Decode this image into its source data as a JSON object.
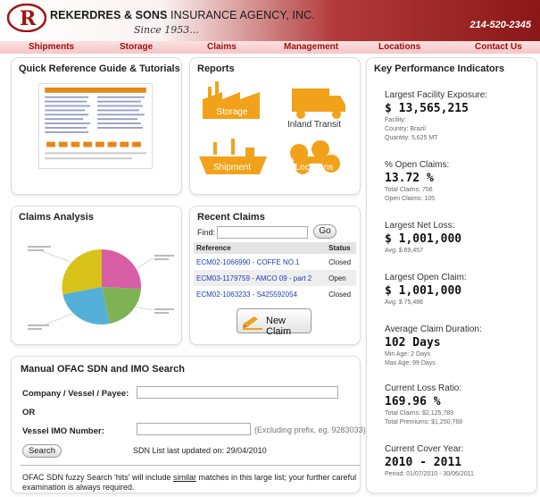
{
  "header": {
    "brand_bold": "REKERDRES & SONS",
    "brand_rest": " INSURANCE AGENCY, INC.",
    "since": "Since 1953...",
    "phone": "214-520-2345"
  },
  "nav": [
    {
      "label": "Shipments"
    },
    {
      "label": "Storage"
    },
    {
      "label": "Claims"
    },
    {
      "label": "Management"
    },
    {
      "label": "Locations"
    },
    {
      "label": "Contact Us"
    }
  ],
  "quick_reference": {
    "title": "Quick Reference Guide & Tutorials"
  },
  "reports": {
    "title": "Reports",
    "items": [
      {
        "label": "Storage",
        "icon": "warehouse-icon"
      },
      {
        "label": "Inland Transit",
        "icon": "truck-icon"
      },
      {
        "label": "Shipment",
        "icon": "ship-icon"
      },
      {
        "label": "Locations",
        "icon": "vehicles-icon"
      }
    ]
  },
  "claims_analysis": {
    "title": "Claims Analysis"
  },
  "recent_claims": {
    "title": "Recent Claims",
    "find_label": "Find:",
    "go_label": "Go",
    "columns": [
      "Reference",
      "Status"
    ],
    "rows": [
      {
        "reference": "ECM02-1066990 - COFFE NO.1",
        "status": "Closed"
      },
      {
        "reference": "ECM03-1179759 - AMCO 09 - part 2",
        "status": "Open"
      },
      {
        "reference": "ECM02-1063233 - S425592054",
        "status": "Closed"
      }
    ],
    "new_claim_label": "New Claim"
  },
  "ofac": {
    "title": "Manual OFAC SDN and IMO Search",
    "company_label": "Company / Vessel / Payee:",
    "or_label": "OR",
    "imo_label": "Vessel IMO Number:",
    "imo_hint": "(Excluding prefix, eg. 9283033)",
    "search_label": "Search",
    "sdn_updated": "SDN List last updated on: 29/04/2010",
    "note_before": "OFAC SDN fuzzy Search 'hits' will include ",
    "note_link": "similar",
    "note_after": " matches in this large list; your further careful examination is always required."
  },
  "kpi": {
    "title": "Key Performance Indicators",
    "items": [
      {
        "title": "Largest Facility Exposure:",
        "value": "$ 13,565,215",
        "subs": [
          "Facility:",
          "Country: Brazil",
          "Quantity: 5,625 MT"
        ]
      },
      {
        "title": "% Open Claims:",
        "value": "13.72 %",
        "subs": [
          "Total Claims: 756",
          "Open Claims: 105"
        ]
      },
      {
        "title": "Largest Net Loss:",
        "value": "$ 1,001,000",
        "subs": [
          "Avg: $ 69,457"
        ]
      },
      {
        "title": "Largest Open Claim:",
        "value": "$ 1,001,000",
        "subs": [
          "Avg: $ 75,486"
        ]
      },
      {
        "title": "Average Claim Duration:",
        "value": "102 Days",
        "subs": [
          "Min Age: 2 Days",
          "Max Age: 99 Days"
        ]
      },
      {
        "title": "Current Loss Ratio:",
        "value": "169.96 %",
        "subs": [
          "Total Claims: $2,125,789",
          "Total Premiums: $1,250,768"
        ]
      },
      {
        "title": "Current Cover Year:",
        "value": "2010 - 2011",
        "subs": [
          "Period: 01/07/2010 - 30/06/2011"
        ]
      }
    ]
  },
  "colors": {
    "brand_red": "#9a1010",
    "link_blue": "#1b3fb6",
    "report_orange": "#f2a21a",
    "pie_yellow": "#d9c21a",
    "pie_pink": "#d85fa6",
    "pie_green": "#7fb255",
    "pie_blue": "#54b0d8"
  }
}
